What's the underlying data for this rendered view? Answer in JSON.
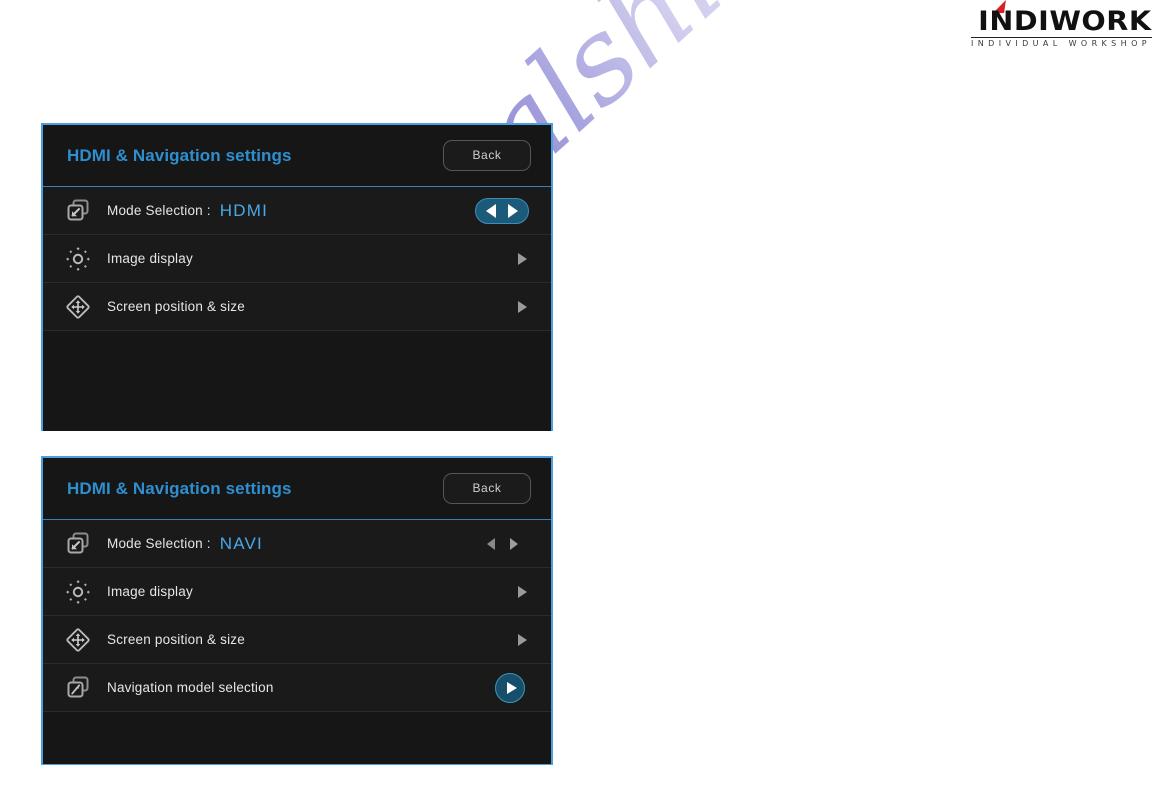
{
  "brand": {
    "name": "INDIWORK",
    "tagline": "INDIVIDUAL WORKSHOP",
    "accent_color": "#d81f26"
  },
  "watermark": {
    "text": "manualshive.com"
  },
  "theme": {
    "panel_border": "#4a9fe0",
    "panel_bg": "#141414",
    "row_bg": "#1a1a1a",
    "title_color": "#2e8fd0",
    "value_color": "#4aa8e8",
    "label_color": "#e6e6e6",
    "highlight_pill": "#1c5a7a",
    "chevron_color": "#9a9a9a"
  },
  "panels": [
    {
      "id": "hdmi",
      "header": {
        "title": "HDMI & Navigation settings",
        "back_label": "Back"
      },
      "rows": [
        {
          "icon": "window-restore-icon",
          "label": "Mode Selection :",
          "value": "HDMI",
          "control": "arrow-pill",
          "highlighted": true
        },
        {
          "icon": "brightness-icon",
          "label": "Image display",
          "value": "",
          "control": "chevron",
          "highlighted": false
        },
        {
          "icon": "move-diamond-icon",
          "label": "Screen position & size",
          "value": "",
          "control": "chevron",
          "highlighted": false
        }
      ]
    },
    {
      "id": "navi",
      "header": {
        "title": "HDMI & Navigation settings",
        "back_label": "Back"
      },
      "rows": [
        {
          "icon": "window-restore-icon",
          "label": "Mode Selection :",
          "value": "NAVI",
          "control": "arrow-plain",
          "highlighted": false
        },
        {
          "icon": "brightness-icon",
          "label": "Image display",
          "value": "",
          "control": "chevron",
          "highlighted": false
        },
        {
          "icon": "move-diamond-icon",
          "label": "Screen position & size",
          "value": "",
          "control": "chevron",
          "highlighted": false
        },
        {
          "icon": "navigation-compass-icon",
          "label": "Navigation model selection",
          "value": "",
          "control": "play-circle",
          "highlighted": true
        }
      ]
    }
  ]
}
